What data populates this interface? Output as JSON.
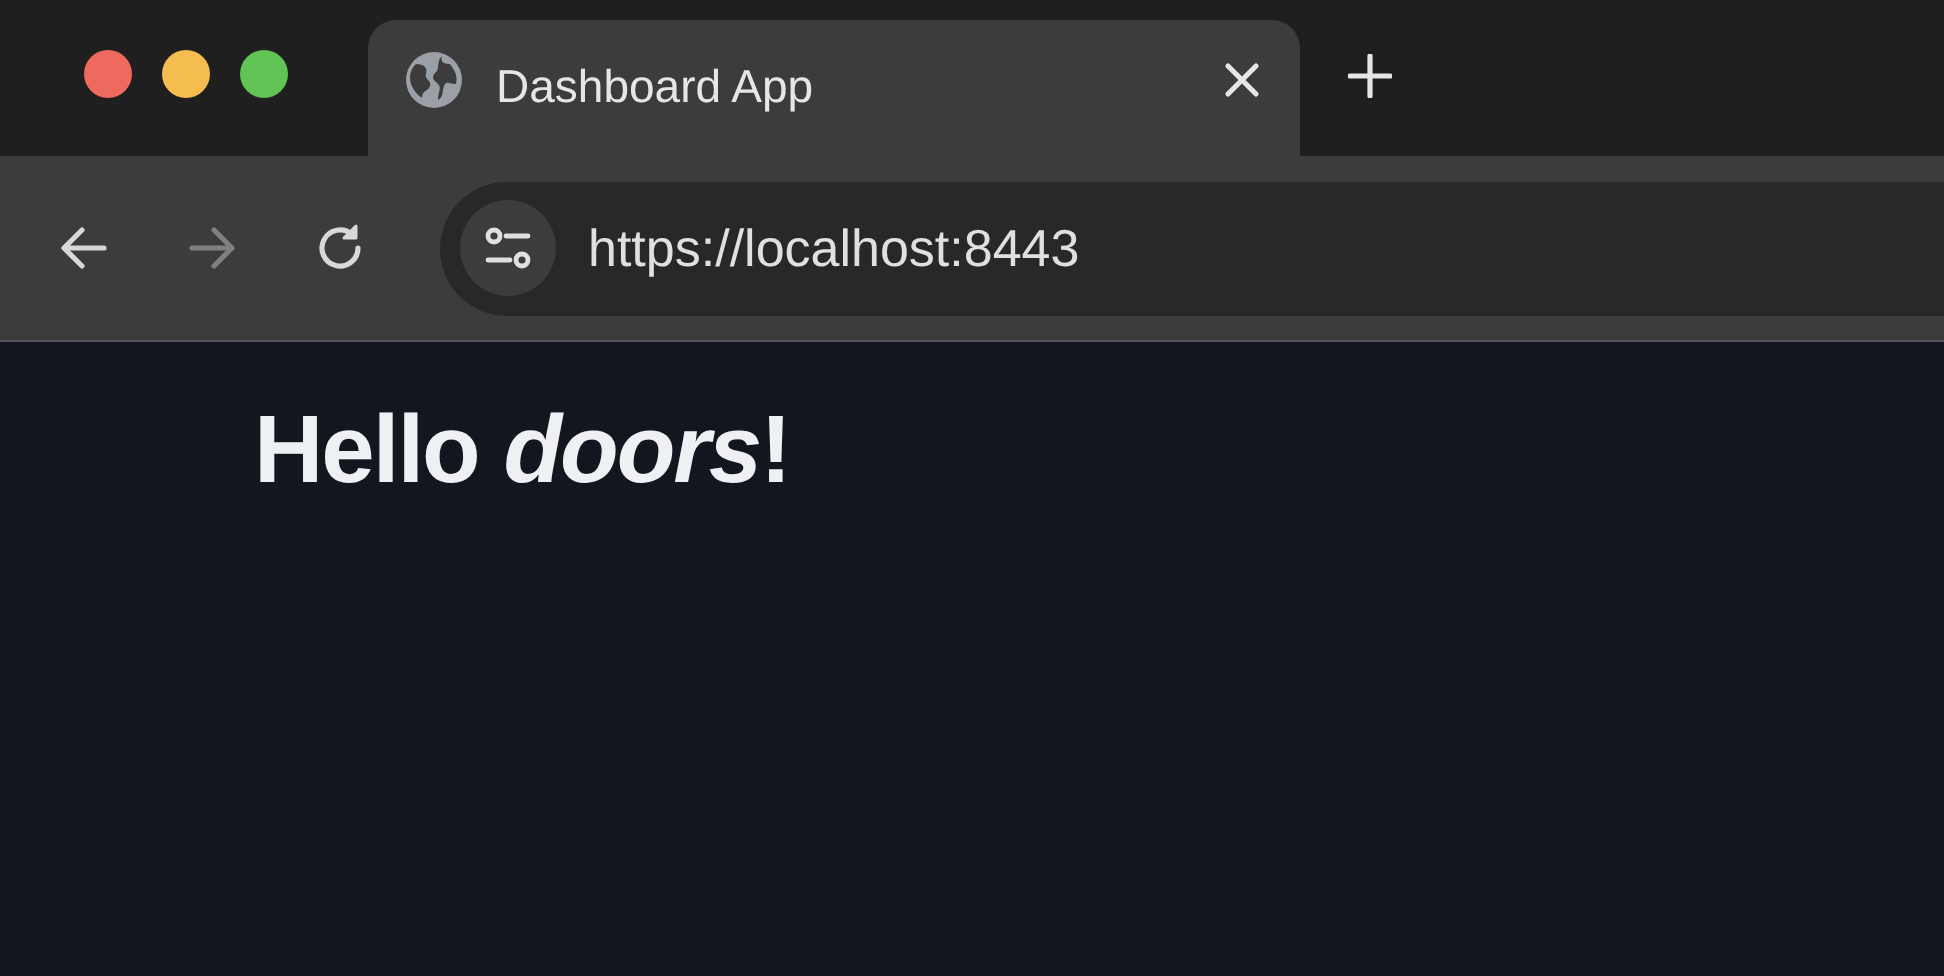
{
  "tabs": [
    {
      "title": "Dashboard App",
      "selected": true
    }
  ],
  "toolbar": {
    "back_disabled": false,
    "forward_disabled": true,
    "address": "https://localhost:8443"
  },
  "page": {
    "heading": "Hello *doors*!"
  }
}
